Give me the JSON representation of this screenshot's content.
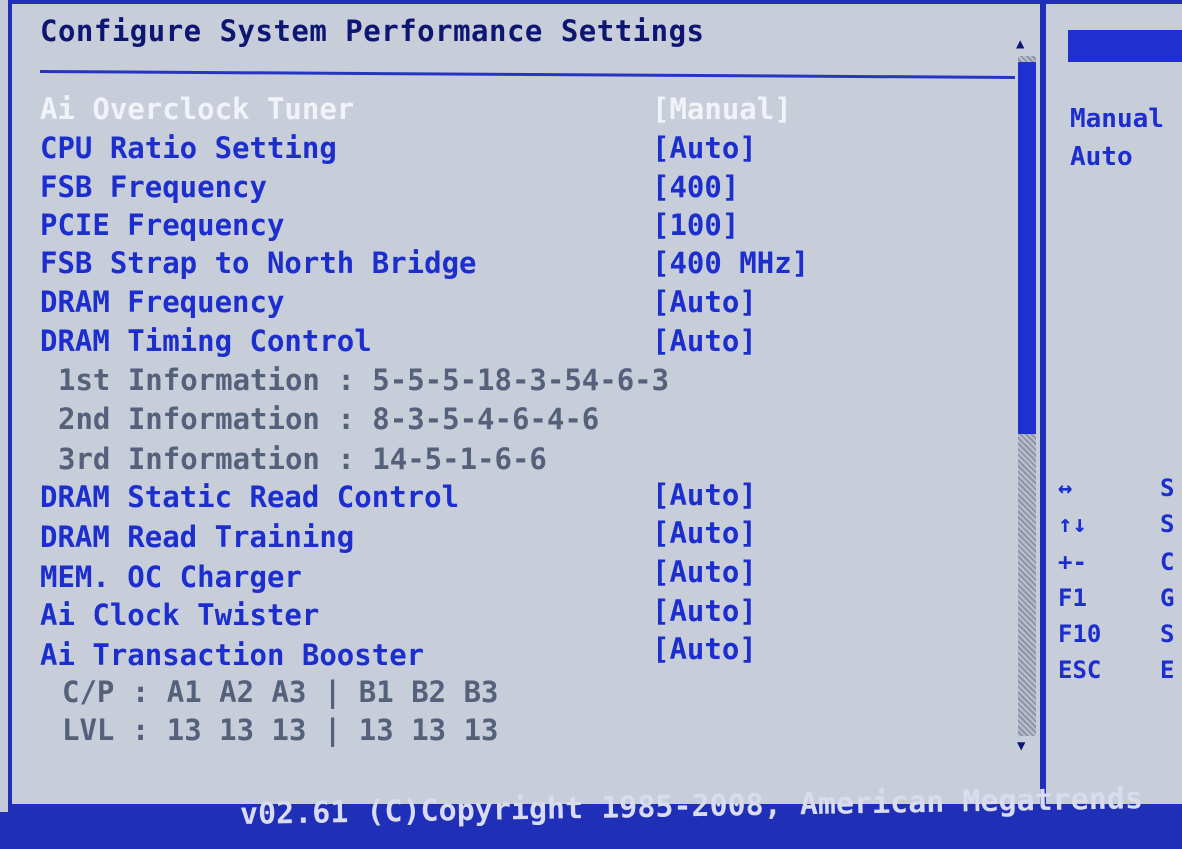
{
  "title": "Configure System Performance Settings",
  "settings": [
    {
      "label": "Ai Overclock Tuner",
      "value": "[Manual]",
      "selected": true
    },
    {
      "label": "CPU Ratio Setting",
      "value": "[Auto]"
    },
    {
      "label": "FSB Frequency",
      "value": "[400]"
    },
    {
      "label": "PCIE Frequency",
      "value": "[100]"
    },
    {
      "label": "FSB Strap to North Bridge",
      "value": "[400 MHz]"
    },
    {
      "label": "DRAM Frequency",
      "value": "[Auto]"
    },
    {
      "label": "DRAM Timing Control",
      "value": "[Auto]"
    },
    {
      "label": "DRAM Static Read Control",
      "value": "[Auto]"
    },
    {
      "label": "DRAM Read Training",
      "value": "[Auto]"
    },
    {
      "label": "MEM. OC Charger",
      "value": "[Auto]"
    },
    {
      "label": "Ai Clock Twister",
      "value": "[Auto]"
    },
    {
      "label": "Ai Transaction Booster",
      "value": "[Auto]"
    }
  ],
  "info": {
    "first": "1st Information : 5-5-5-18-3-54-6-3",
    "second": "2nd Information : 8-3-5-4-6-4-6",
    "third": "3rd Information : 14-5-1-6-6",
    "cp": "C/P : A1 A2 A3 | B1 B2 B3",
    "lvl": "LVL : 13 13 13 | 13 13 13"
  },
  "side": {
    "options": [
      "Manual",
      "Auto"
    ],
    "keys": [
      {
        "key": "↔",
        "desc": "S"
      },
      {
        "key": "↑↓",
        "desc": "S"
      },
      {
        "key": "+-",
        "desc": "C"
      },
      {
        "key": "F1",
        "desc": "G"
      },
      {
        "key": "F10",
        "desc": "S"
      },
      {
        "key": "ESC",
        "desc": "E"
      }
    ]
  },
  "scrollbar": {
    "up_arrow": "▲",
    "down_arrow": "▼"
  },
  "footer": "v02.61 (C)Copyright 1985-2008, American Megatrends"
}
